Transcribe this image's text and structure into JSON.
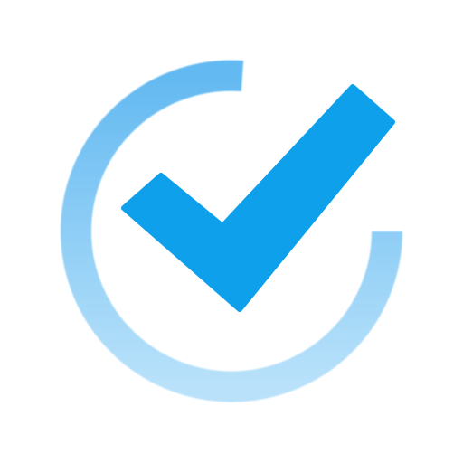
{
  "logo": {
    "name": "checkmark-circle-logo",
    "icon": "checkmark-icon",
    "colors": {
      "background": "#ffffff",
      "check": "#0ea0eb",
      "ring_top": "#63b9f1",
      "ring_bottom": "#b9e2fa"
    }
  }
}
